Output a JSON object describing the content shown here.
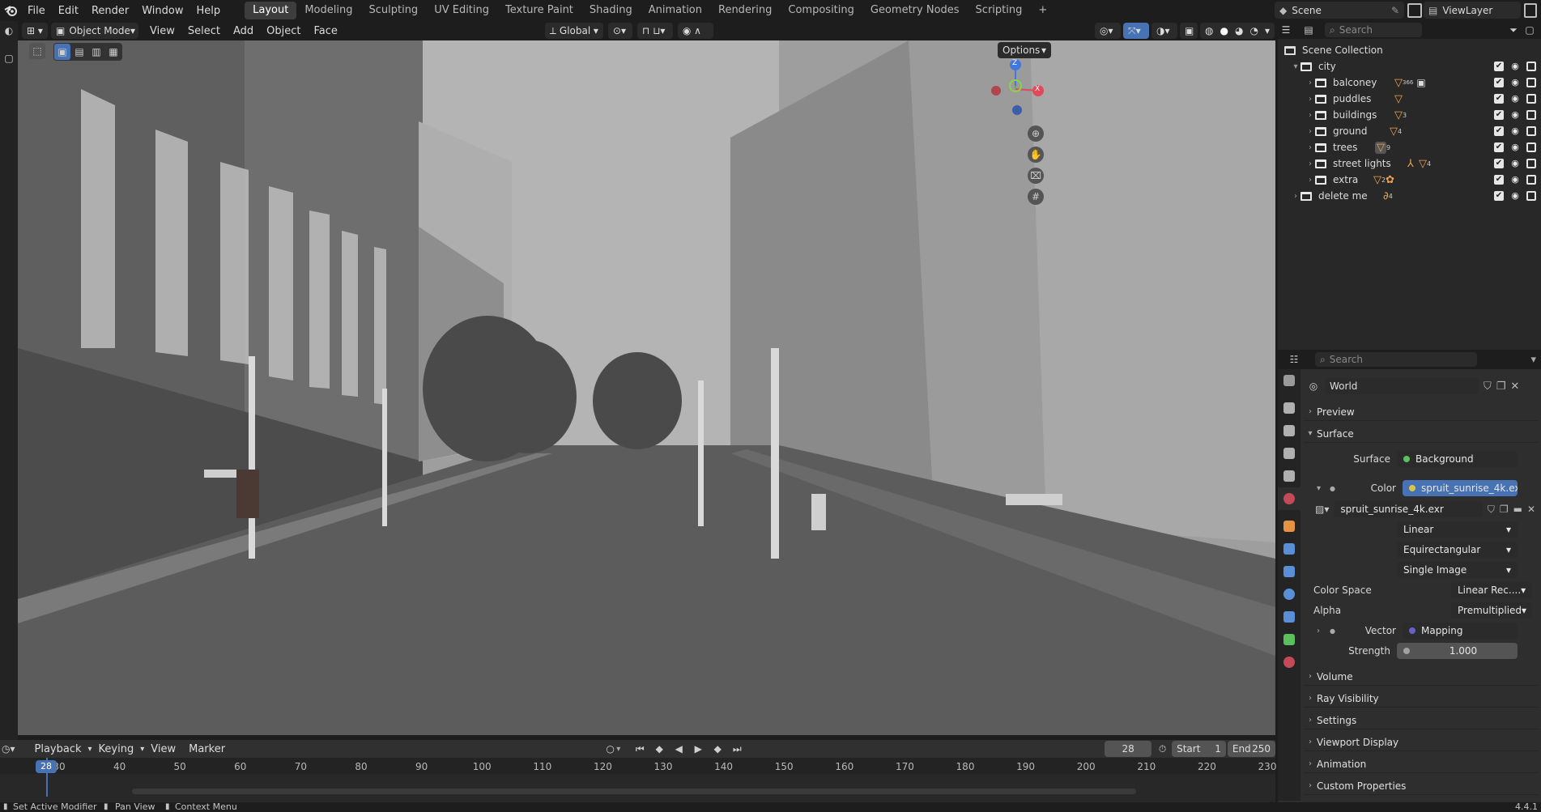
{
  "menubar": {
    "items": [
      "File",
      "Edit",
      "Render",
      "Window",
      "Help"
    ]
  },
  "workspaces": [
    "Layout",
    "Modeling",
    "Sculpting",
    "UV Editing",
    "Texture Paint",
    "Shading",
    "Animation",
    "Rendering",
    "Compositing",
    "Geometry Nodes",
    "Scripting"
  ],
  "scene": {
    "name": "Scene",
    "viewlayer": "ViewLayer"
  },
  "viewport_header": {
    "mode": "Object Mode",
    "menus": [
      "View",
      "Select",
      "Add",
      "Object",
      "Face"
    ],
    "orientation": "Global",
    "options": "Options"
  },
  "gizmo": {
    "x": "X",
    "y": "Y",
    "z": "Z"
  },
  "outliner": {
    "search_placeholder": "Search",
    "root": "Scene Collection",
    "rows": [
      {
        "label": "city",
        "badge": ""
      },
      {
        "label": "balconey",
        "badge": "366"
      },
      {
        "label": "puddles",
        "badge": ""
      },
      {
        "label": "buildings",
        "badge": "3"
      },
      {
        "label": "ground",
        "badge": "4"
      },
      {
        "label": "trees",
        "badge": "9"
      },
      {
        "label": "street lights",
        "badge": "4"
      },
      {
        "label": "extra",
        "badge": "2"
      },
      {
        "label": "delete me",
        "badge": "4"
      }
    ]
  },
  "properties": {
    "search_placeholder": "Search",
    "world_name": "World",
    "sections": {
      "preview": "Preview",
      "surface": "Surface",
      "volume": "Volume",
      "ray_visibility": "Ray Visibility",
      "settings": "Settings",
      "viewport_display": "Viewport Display",
      "animation": "Animation",
      "custom_properties": "Custom Properties"
    },
    "surface": {
      "label": "Surface",
      "value": "Background"
    },
    "color": {
      "label": "Color",
      "value": "spruit_sunrise_4k.exr"
    },
    "image_name": "spruit_sunrise_4k.exr",
    "interpolation": "Linear",
    "projection": "Equirectangular",
    "source": "Single Image",
    "color_space": {
      "label": "Color Space",
      "value": "Linear Rec...."
    },
    "alpha": {
      "label": "Alpha",
      "value": "Premultiplied"
    },
    "vector": {
      "label": "Vector",
      "value": "Mapping"
    },
    "strength": {
      "label": "Strength",
      "value": "1.000"
    }
  },
  "timeline": {
    "menus": [
      "Playback",
      "Keying",
      "View",
      "Marker"
    ],
    "current_frame": "28",
    "start_label": "Start",
    "start": "1",
    "end_label": "End",
    "end": "250",
    "ticks": [
      "30",
      "40",
      "50",
      "60",
      "70",
      "80",
      "90",
      "100",
      "110",
      "120",
      "130",
      "140",
      "150",
      "160",
      "170",
      "180",
      "190",
      "200",
      "210",
      "220",
      "230"
    ]
  },
  "statusbar": {
    "items": [
      "Set Active Modifier",
      "Pan View",
      "Context Menu"
    ],
    "version": "4.4.1"
  }
}
